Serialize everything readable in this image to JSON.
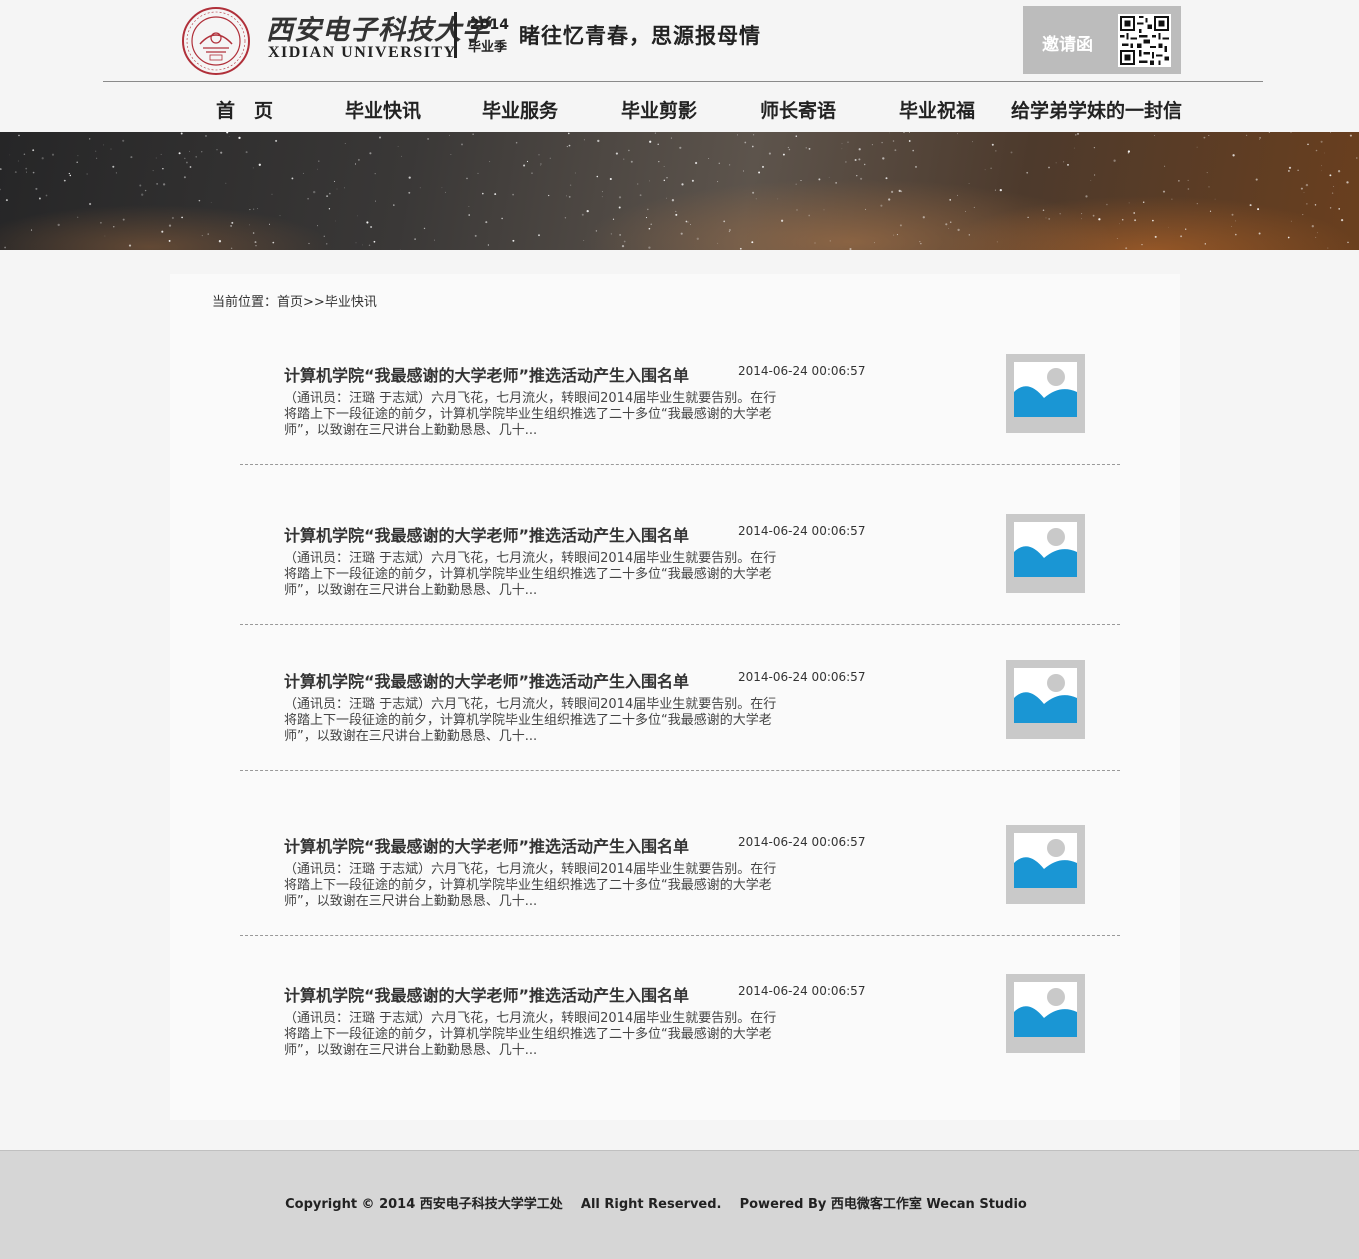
{
  "header": {
    "logo_cn": "西安电子科技大学",
    "logo_en": "XIDIAN UNIVERSITY",
    "season_year": "2014",
    "season_label": "毕业季",
    "slogan": "睹往忆青春，思源报母情",
    "invite_label": "邀请函"
  },
  "nav": {
    "items": [
      {
        "label": "首　页"
      },
      {
        "label": "毕业快讯"
      },
      {
        "label": "毕业服务"
      },
      {
        "label": "毕业剪影"
      },
      {
        "label": "师长寄语"
      },
      {
        "label": "毕业祝福"
      },
      {
        "label": "给学弟学妹的一封信"
      }
    ]
  },
  "breadcrumb": {
    "prefix": "当前位置：",
    "home": "首页",
    "separator": ">>",
    "current": "毕业快讯"
  },
  "news": [
    {
      "title": "计算机学院“我最感谢的大学老师”推选活动产生入围名单",
      "date": "2014-06-24 00:06:57",
      "summary": "（通讯员：汪璐 于志斌）六月飞花，七月流火，转眼间2014届毕业生就要告别。在行将踏上下一段征途的前夕，计算机学院毕业生组织推选了二十多位“我最感谢的大学老师”，以致谢在三尺讲台上勤勤恳恳、几十..."
    },
    {
      "title": "计算机学院“我最感谢的大学老师”推选活动产生入围名单",
      "date": "2014-06-24 00:06:57",
      "summary": "（通讯员：汪璐 于志斌）六月飞花，七月流火，转眼间2014届毕业生就要告别。在行将踏上下一段征途的前夕，计算机学院毕业生组织推选了二十多位“我最感谢的大学老师”，以致谢在三尺讲台上勤勤恳恳、几十..."
    },
    {
      "title": "计算机学院“我最感谢的大学老师”推选活动产生入围名单",
      "date": "2014-06-24 00:06:57",
      "summary": "（通讯员：汪璐 于志斌）六月飞花，七月流火，转眼间2014届毕业生就要告别。在行将踏上下一段征途的前夕，计算机学院毕业生组织推选了二十多位“我最感谢的大学老师”，以致谢在三尺讲台上勤勤恳恳、几十..."
    },
    {
      "title": "计算机学院“我最感谢的大学老师”推选活动产生入围名单",
      "date": "2014-06-24 00:06:57",
      "summary": "（通讯员：汪璐 于志斌）六月飞花，七月流火，转眼间2014届毕业生就要告别。在行将踏上下一段征途的前夕，计算机学院毕业生组织推选了二十多位“我最感谢的大学老师”，以致谢在三尺讲台上勤勤恳恳、几十..."
    },
    {
      "title": "计算机学院“我最感谢的大学老师”推选活动产生入围名单",
      "date": "2014-06-24 00:06:57",
      "summary": "（通讯员：汪璐 于志斌）六月飞花，七月流火，转眼间2014届毕业生就要告别。在行将踏上下一段征途的前夕，计算机学院毕业生组织推选了二十多位“我最感谢的大学老师”，以致谢在三尺讲台上勤勤恳恳、几十..."
    }
  ],
  "footer": {
    "text": "Copyright © 2014 西安电子科技大学学工处    All Right Reserved.    Powered By 西电微客工作室 Wecan Studio"
  },
  "icons": {
    "logo": "university-seal-icon",
    "qr": "qr-code-icon",
    "thumb": "image-placeholder-icon"
  },
  "colors": {
    "thumb_frame": "#c9c9c9",
    "thumb_sky": "#1a96d4",
    "footer_bg": "#d6d6d6",
    "invite_bg": "#bcbcbc"
  }
}
